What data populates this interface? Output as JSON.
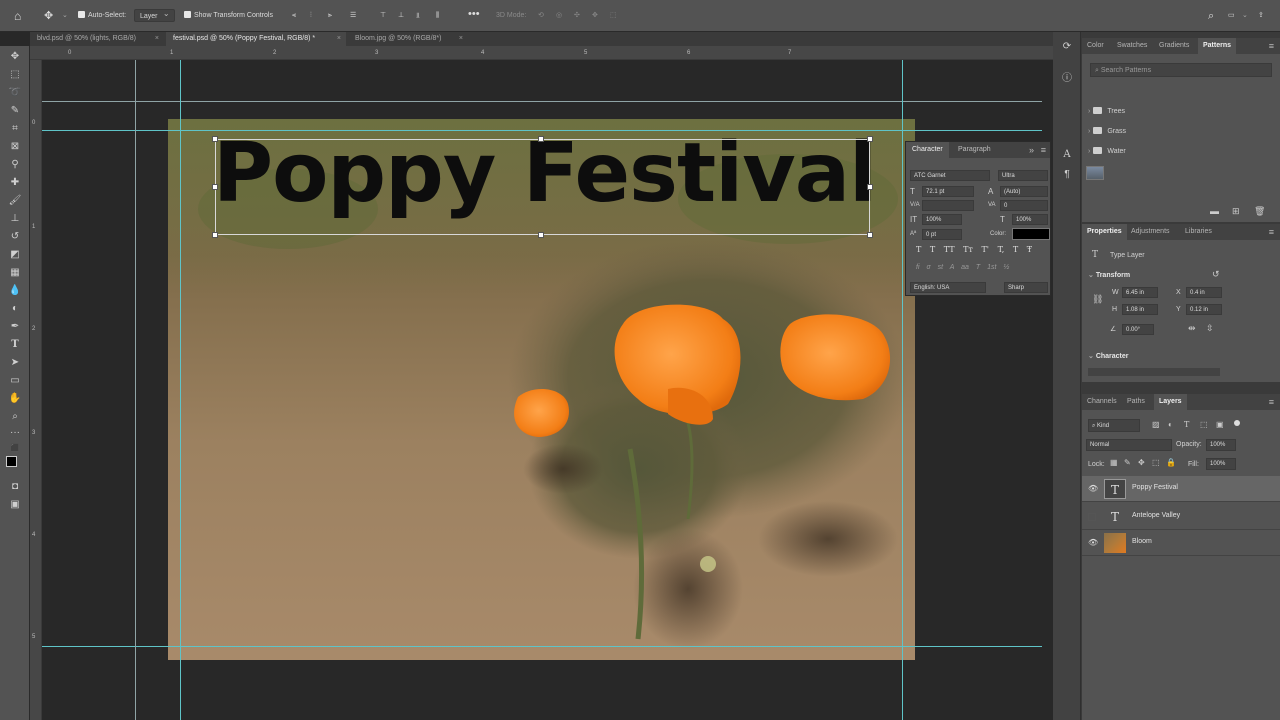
{
  "options_bar": {
    "auto_select_label": "Auto-Select:",
    "auto_select_value": "Layer",
    "show_transform_label": "Show Transform Controls",
    "mode_3d": "3D Mode:"
  },
  "tabs": [
    {
      "label": "blvd.psd @ 50% (lights, RGB/8)"
    },
    {
      "label": "festival.psd @ 50% (Poppy Festival, RGB/8) *"
    },
    {
      "label": "Bloom.jpg @ 50% (RGB/8*)"
    }
  ],
  "ruler": {
    "h_labels": [
      "0",
      "1",
      "2",
      "3",
      "4",
      "5",
      "6",
      "7"
    ],
    "v_labels": [
      "0",
      "1",
      "2",
      "3",
      "4",
      "5"
    ]
  },
  "canvas": {
    "headline": "Poppy Festival"
  },
  "character_panel": {
    "tabs": [
      "Character",
      "Paragraph"
    ],
    "font_family": "ATC Garnet",
    "font_style": "Ultra",
    "font_size": "72.1 pt",
    "leading": "(Auto)",
    "tracking": "0",
    "vertical_scale": "100%",
    "horizontal_scale": "100%",
    "baseline_shift": "0 pt",
    "color_label": "Color:",
    "language": "English: USA",
    "antialias": "Sharp",
    "style_buttons": [
      "T",
      "T",
      "TT",
      "Tт",
      "T'",
      "T,",
      "T",
      "Ŧ"
    ],
    "glyph_buttons": [
      "fi",
      "σ",
      "st",
      "A",
      "aa",
      "T",
      "1st",
      "½"
    ],
    "colors": {
      "text": "#000000"
    }
  },
  "patterns_panel": {
    "tabs": [
      "Color",
      "Swatches",
      "Gradients",
      "Patterns"
    ],
    "search_placeholder": "Search Patterns",
    "folders": [
      "Trees",
      "Grass",
      "Water"
    ]
  },
  "properties_panel": {
    "tabs": [
      "Properties",
      "Adjustments",
      "Libraries"
    ],
    "layer_type": "Type Layer",
    "transform_label": "Transform",
    "w": "6.45 in",
    "x": "0.4 in",
    "h": "1.08 in",
    "y": "0.12 in",
    "angle": "0.00°",
    "w_label": "W",
    "h_label": "H",
    "x_label": "X",
    "y_label": "Y",
    "character_label": "Character"
  },
  "layers_panel": {
    "tabs": [
      "Channels",
      "Paths",
      "Layers"
    ],
    "kind_label": "Kind",
    "blend_mode": "Normal",
    "opacity_label": "Opacity:",
    "opacity": "100%",
    "lock_label": "Lock:",
    "fill_label": "Fill:",
    "fill": "100%",
    "layers": [
      {
        "name": "Poppy Festival",
        "type": "text",
        "visible": true,
        "selected": true
      },
      {
        "name": "Antelope Valley",
        "type": "text",
        "visible": false,
        "selected": false
      },
      {
        "name": "Bloom",
        "type": "image",
        "visible": true,
        "selected": false
      }
    ]
  }
}
